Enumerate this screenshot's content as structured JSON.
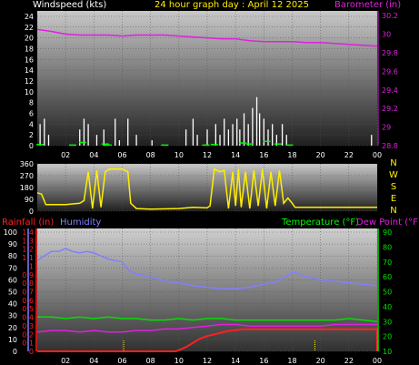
{
  "header": {
    "windspeed_label": "Windspeed (kts)",
    "title": "24 hour graph day : April 12 2025",
    "barometer_label": "Barometer (in)"
  },
  "labels": {
    "rainfall": "Rainfall (in)",
    "humidity": "Humidity",
    "temperature": "Temperature (°F)",
    "dewpoint": "Dew Point (°F)"
  },
  "compass": [
    "N",
    "W",
    "S",
    "E",
    "N"
  ],
  "colors": {
    "barometer": "#e020e0",
    "wind": "#ffffff",
    "gust_low": "#00ff00",
    "direction": "#ffee00",
    "rain": "#ff2020",
    "humidity": "#8080ff",
    "temperature": "#00e000",
    "dewpoint": "#e020e0"
  },
  "chart_data": [
    {
      "type": "line",
      "name": "wind-barometer",
      "x_ticks": [
        "02",
        "04",
        "06",
        "08",
        "10",
        "12",
        "14",
        "16",
        "18",
        "20",
        "22",
        "00"
      ],
      "y_left_ticks": [
        "0",
        "2",
        "4",
        "6",
        "8",
        "10",
        "12",
        "14",
        "16",
        "18",
        "20",
        "22",
        "24"
      ],
      "y_right_ticks": [
        "28.8",
        "29",
        "29.2",
        "29.4",
        "29.6",
        "29.8",
        "30",
        "30.2"
      ],
      "ylim_left": [
        0,
        25
      ],
      "ylim_right": [
        28.8,
        30.25
      ],
      "barometer": [
        [
          0,
          30.05
        ],
        [
          1,
          30.03
        ],
        [
          2,
          30.0
        ],
        [
          3,
          29.99
        ],
        [
          4,
          29.99
        ],
        [
          5,
          29.99
        ],
        [
          6,
          29.98
        ],
        [
          7,
          29.99
        ],
        [
          8,
          29.99
        ],
        [
          9,
          29.99
        ],
        [
          10,
          29.98
        ],
        [
          11,
          29.97
        ],
        [
          12,
          29.96
        ],
        [
          13,
          29.95
        ],
        [
          14,
          29.95
        ],
        [
          15,
          29.93
        ],
        [
          16,
          29.92
        ],
        [
          17,
          29.92
        ],
        [
          18,
          29.92
        ],
        [
          19,
          29.91
        ],
        [
          20,
          29.91
        ],
        [
          21,
          29.9
        ],
        [
          22,
          29.89
        ],
        [
          23,
          29.88
        ],
        [
          24,
          29.87
        ]
      ],
      "wind_bars": [
        [
          0.2,
          4
        ],
        [
          0.5,
          5
        ],
        [
          0.8,
          2
        ],
        [
          3.0,
          3
        ],
        [
          3.3,
          5
        ],
        [
          3.6,
          4
        ],
        [
          4.2,
          2
        ],
        [
          4.7,
          3
        ],
        [
          5.5,
          5
        ],
        [
          5.8,
          1
        ],
        [
          6.4,
          5
        ],
        [
          7.0,
          2
        ],
        [
          8.1,
          1
        ],
        [
          10.5,
          3
        ],
        [
          11.0,
          5
        ],
        [
          11.3,
          2
        ],
        [
          12.0,
          3
        ],
        [
          12.6,
          4
        ],
        [
          12.9,
          2
        ],
        [
          13.2,
          5
        ],
        [
          13.5,
          3
        ],
        [
          13.8,
          4
        ],
        [
          14.1,
          5
        ],
        [
          14.3,
          3
        ],
        [
          14.6,
          6
        ],
        [
          14.9,
          4
        ],
        [
          15.2,
          7
        ],
        [
          15.5,
          9
        ],
        [
          15.7,
          6
        ],
        [
          16.0,
          5
        ],
        [
          16.3,
          3
        ],
        [
          16.6,
          4
        ],
        [
          16.9,
          2
        ],
        [
          17.3,
          4
        ],
        [
          17.6,
          2
        ],
        [
          23.6,
          2
        ]
      ],
      "gust_low": [
        [
          0.2,
          0.2
        ],
        [
          2.5,
          0.1
        ],
        [
          3.2,
          0.6
        ],
        [
          4.8,
          0.3
        ],
        [
          5.0,
          0.1
        ],
        [
          9.0,
          0.1
        ],
        [
          11.9,
          0.1
        ],
        [
          12.5,
          0.2
        ],
        [
          14.5,
          0.5
        ],
        [
          15.0,
          0.3
        ],
        [
          16.2,
          0.8
        ],
        [
          17.0,
          0.3
        ],
        [
          17.8,
          0.1
        ]
      ]
    },
    {
      "type": "line",
      "name": "wind-direction",
      "x_ticks": [
        "02",
        "04",
        "06",
        "08",
        "10",
        "12",
        "14",
        "16",
        "18",
        "20",
        "22",
        "00"
      ],
      "y_ticks": [
        "0",
        "90",
        "180",
        "270",
        "360"
      ],
      "ylim": [
        0,
        360
      ],
      "values": [
        [
          0,
          140
        ],
        [
          0.3,
          130
        ],
        [
          0.6,
          50
        ],
        [
          2.0,
          50
        ],
        [
          3.0,
          60
        ],
        [
          3.3,
          80
        ],
        [
          3.6,
          300
        ],
        [
          3.9,
          20
        ],
        [
          4.2,
          310
        ],
        [
          4.5,
          30
        ],
        [
          4.8,
          300
        ],
        [
          5.1,
          320
        ],
        [
          6.0,
          320
        ],
        [
          6.4,
          300
        ],
        [
          6.6,
          60
        ],
        [
          7.0,
          20
        ],
        [
          8.0,
          15
        ],
        [
          10.0,
          20
        ],
        [
          11.0,
          30
        ],
        [
          12.0,
          25
        ],
        [
          12.2,
          40
        ],
        [
          12.5,
          320
        ],
        [
          12.9,
          300
        ],
        [
          13.2,
          310
        ],
        [
          13.5,
          20
        ],
        [
          13.8,
          300
        ],
        [
          14.0,
          40
        ],
        [
          14.2,
          320
        ],
        [
          14.4,
          30
        ],
        [
          14.7,
          300
        ],
        [
          15.0,
          20
        ],
        [
          15.3,
          310
        ],
        [
          15.6,
          40
        ],
        [
          15.9,
          320
        ],
        [
          16.2,
          20
        ],
        [
          16.5,
          300
        ],
        [
          16.8,
          40
        ],
        [
          17.1,
          310
        ],
        [
          17.4,
          60
        ],
        [
          17.7,
          100
        ],
        [
          18.0,
          60
        ],
        [
          18.2,
          30
        ],
        [
          19.0,
          30
        ],
        [
          24.0,
          30
        ]
      ]
    },
    {
      "type": "line",
      "name": "rain-humidity-temperature",
      "x_ticks": [
        "02",
        "04",
        "06",
        "08",
        "10",
        "12",
        "14",
        "16",
        "18",
        "20",
        "22",
        "00"
      ],
      "y_humidity_ticks": [
        "0",
        "10",
        "20",
        "30",
        "40",
        "50",
        "60",
        "70",
        "80",
        "90",
        "100"
      ],
      "y_rain_ticks": [
        "0",
        "0.1",
        "0.2",
        "0.3",
        "0.4",
        "0.5",
        "0.6",
        "0.7",
        "0.8",
        "0.9",
        "1",
        "1.1",
        "1.2",
        "1.3",
        "1.4"
      ],
      "y_temp_ticks": [
        "10",
        "20",
        "30",
        "40",
        "50",
        "60",
        "70",
        "80",
        "90"
      ],
      "ylim_humidity": [
        0,
        100
      ],
      "ylim_rain": [
        0,
        1.4
      ],
      "ylim_temp": [
        10,
        90
      ],
      "humidity": [
        [
          0,
          71
        ],
        [
          0.5,
          74
        ],
        [
          1,
          77
        ],
        [
          1.5,
          77
        ],
        [
          2,
          79
        ],
        [
          2.5,
          77
        ],
        [
          3,
          76
        ],
        [
          3.5,
          77
        ],
        [
          4,
          76
        ],
        [
          4.5,
          74
        ],
        [
          5,
          72
        ],
        [
          6,
          70
        ],
        [
          6.5,
          64
        ],
        [
          7,
          62
        ],
        [
          8,
          60
        ],
        [
          9,
          57
        ],
        [
          10,
          56
        ],
        [
          11,
          54
        ],
        [
          12,
          53
        ],
        [
          13,
          52
        ],
        [
          14,
          52
        ],
        [
          15,
          53
        ],
        [
          16,
          55
        ],
        [
          17,
          57
        ],
        [
          17.5,
          60
        ],
        [
          18,
          63
        ],
        [
          18.5,
          62
        ],
        [
          19,
          60
        ],
        [
          20,
          58
        ],
        [
          21,
          57
        ],
        [
          22,
          56
        ],
        [
          23,
          55
        ],
        [
          24,
          54
        ]
      ],
      "rain": [
        [
          0,
          0
        ],
        [
          9.8,
          0
        ],
        [
          10.5,
          0.05
        ],
        [
          11,
          0.1
        ],
        [
          11.5,
          0.15
        ],
        [
          12,
          0.18
        ],
        [
          12.5,
          0.2
        ],
        [
          13,
          0.22
        ],
        [
          13.5,
          0.24
        ],
        [
          14,
          0.25
        ],
        [
          14.5,
          0.26
        ],
        [
          24,
          0.26
        ],
        [
          24,
          0
        ]
      ],
      "temperature": [
        [
          0,
          33
        ],
        [
          1,
          33
        ],
        [
          2,
          32
        ],
        [
          3,
          33
        ],
        [
          4,
          32
        ],
        [
          5,
          33
        ],
        [
          6,
          32
        ],
        [
          7,
          32
        ],
        [
          8,
          31
        ],
        [
          9,
          31
        ],
        [
          10,
          32
        ],
        [
          11,
          31
        ],
        [
          12,
          32
        ],
        [
          13,
          32
        ],
        [
          14,
          31
        ],
        [
          15,
          31
        ],
        [
          16,
          31
        ],
        [
          17,
          31
        ],
        [
          18,
          31
        ],
        [
          19,
          31
        ],
        [
          20,
          31
        ],
        [
          21,
          31
        ],
        [
          22,
          32
        ],
        [
          23,
          31
        ],
        [
          24,
          30
        ]
      ],
      "dewpoint": [
        [
          0,
          23
        ],
        [
          1,
          24
        ],
        [
          2,
          24
        ],
        [
          3,
          23
        ],
        [
          4,
          24
        ],
        [
          5,
          23
        ],
        [
          6,
          23
        ],
        [
          7,
          24
        ],
        [
          8,
          24
        ],
        [
          9,
          25
        ],
        [
          10,
          25
        ],
        [
          11,
          26
        ],
        [
          12,
          27
        ],
        [
          13,
          28
        ],
        [
          14,
          28
        ],
        [
          15,
          27
        ],
        [
          16,
          27
        ],
        [
          17,
          27
        ],
        [
          18,
          27
        ],
        [
          19,
          27
        ],
        [
          20,
          27
        ],
        [
          21,
          28
        ],
        [
          22,
          28
        ],
        [
          23,
          28
        ],
        [
          24,
          28
        ]
      ],
      "markers_x": [
        6.1,
        19.6
      ]
    }
  ]
}
